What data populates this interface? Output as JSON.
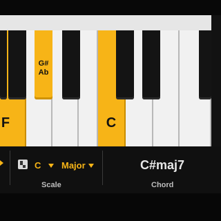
{
  "keyboard": {
    "white_keys": [
      {
        "label": "F",
        "active": true
      },
      {
        "label": "",
        "active": false
      },
      {
        "label": "",
        "active": false
      },
      {
        "label": "",
        "active": false
      },
      {
        "label": "C",
        "active": true
      },
      {
        "label": "",
        "active": false
      },
      {
        "label": "",
        "active": false
      },
      {
        "label": "",
        "active": false
      }
    ],
    "black_keys": [
      {
        "label_top": "",
        "label_bottom": "",
        "active": false
      },
      {
        "label_top": "G#",
        "label_bottom": "Ab",
        "active": true
      },
      {
        "label_top": "",
        "label_bottom": "",
        "active": false
      },
      {
        "label_top": "",
        "label_bottom": "",
        "active": false
      },
      {
        "label_top": "",
        "label_bottom": "",
        "active": false
      },
      {
        "label_top": "",
        "label_bottom": "",
        "active": false
      }
    ]
  },
  "scale": {
    "root": "C",
    "mode": "Major",
    "label": "Scale"
  },
  "chord": {
    "name": "C#maj7",
    "label": "Chord"
  },
  "colors": {
    "accent": "#f7b417",
    "white_key": "#f1f1f1",
    "black_key": "#141414",
    "panel": "#101010"
  }
}
